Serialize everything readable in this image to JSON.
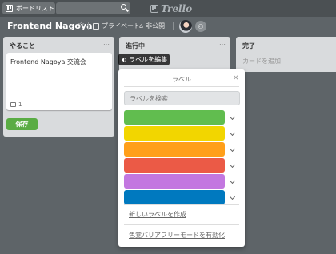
{
  "topbar": {
    "boards_label": "ボードリスト",
    "logo_text": "Trello"
  },
  "board": {
    "title": "Frontend Nagoya",
    "visibility_label": "プライベート",
    "team_label": "非公開"
  },
  "lists": [
    {
      "title": "やること",
      "card": {
        "text": "Frontend Nagoya 交流会",
        "comment_count": "1"
      },
      "save_label": "保存",
      "cancel_hint": "×"
    },
    {
      "title": "進行中"
    },
    {
      "title": "完了",
      "add_card_label": "カードを追加"
    }
  ],
  "edit_labels_button": "ラベルを編集",
  "popover": {
    "title": "ラベル",
    "close": "×",
    "search_placeholder": "ラベルを検索",
    "labels": [
      {
        "color": "#61bd4f"
      },
      {
        "color": "#f2d600"
      },
      {
        "color": "#ff9f1a"
      },
      {
        "color": "#eb5a46"
      },
      {
        "color": "#c377e0"
      },
      {
        "color": "#0079bf"
      }
    ],
    "create_label": "新しいラベルを作成",
    "colorblind_label": "色覚バリアフリーモードを有効化"
  },
  "colors": {
    "save_green": "#5aac44",
    "background": "#5e6468"
  }
}
